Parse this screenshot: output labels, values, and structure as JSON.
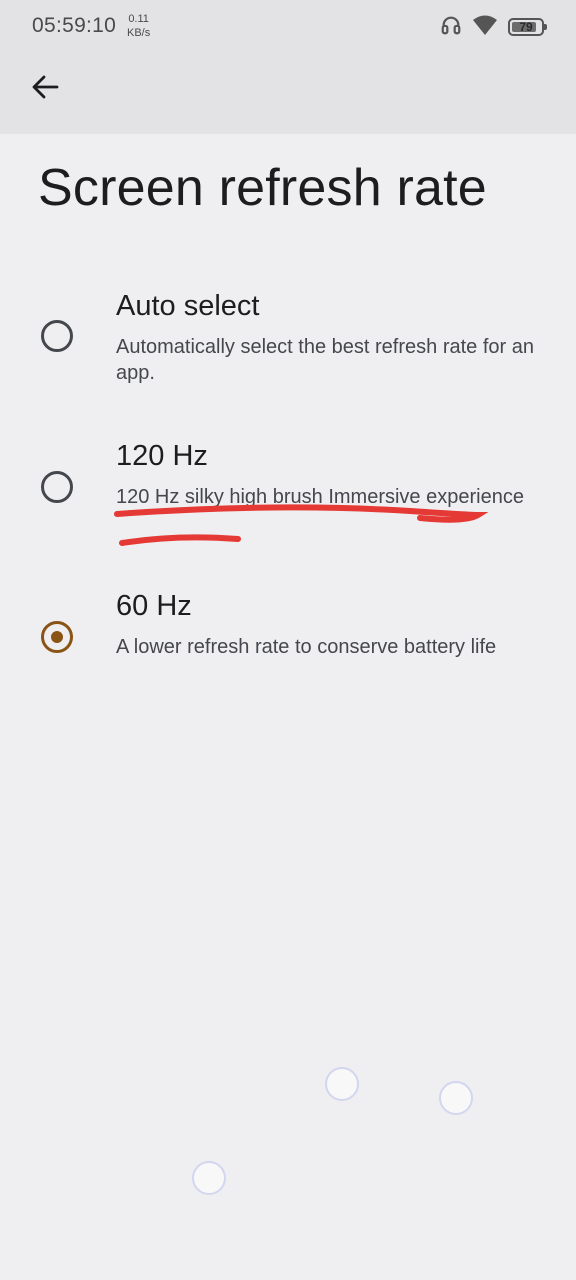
{
  "status_bar": {
    "time": "05:59:10",
    "net_speed_value": "0.11",
    "net_speed_unit": "KB/s",
    "battery_level": "79",
    "icons": [
      "headphones-icon",
      "wifi-icon",
      "battery-icon"
    ]
  },
  "header": {
    "back_icon": "arrow-back-icon"
  },
  "page": {
    "title": "Screen refresh rate"
  },
  "options": [
    {
      "title": "Auto select",
      "description": "Automatically select the best refresh rate for an app.",
      "selected": false
    },
    {
      "title": "120 Hz",
      "description": "120 Hz silky high brush  Immersive experience",
      "selected": false
    },
    {
      "title": "60 Hz",
      "description": "A lower refresh rate to conserve battery life",
      "selected": true
    }
  ],
  "colors": {
    "accent": "#8a5414",
    "annotation": "#e53935",
    "background": "#efeff2",
    "header_background": "#e3e3e5"
  }
}
